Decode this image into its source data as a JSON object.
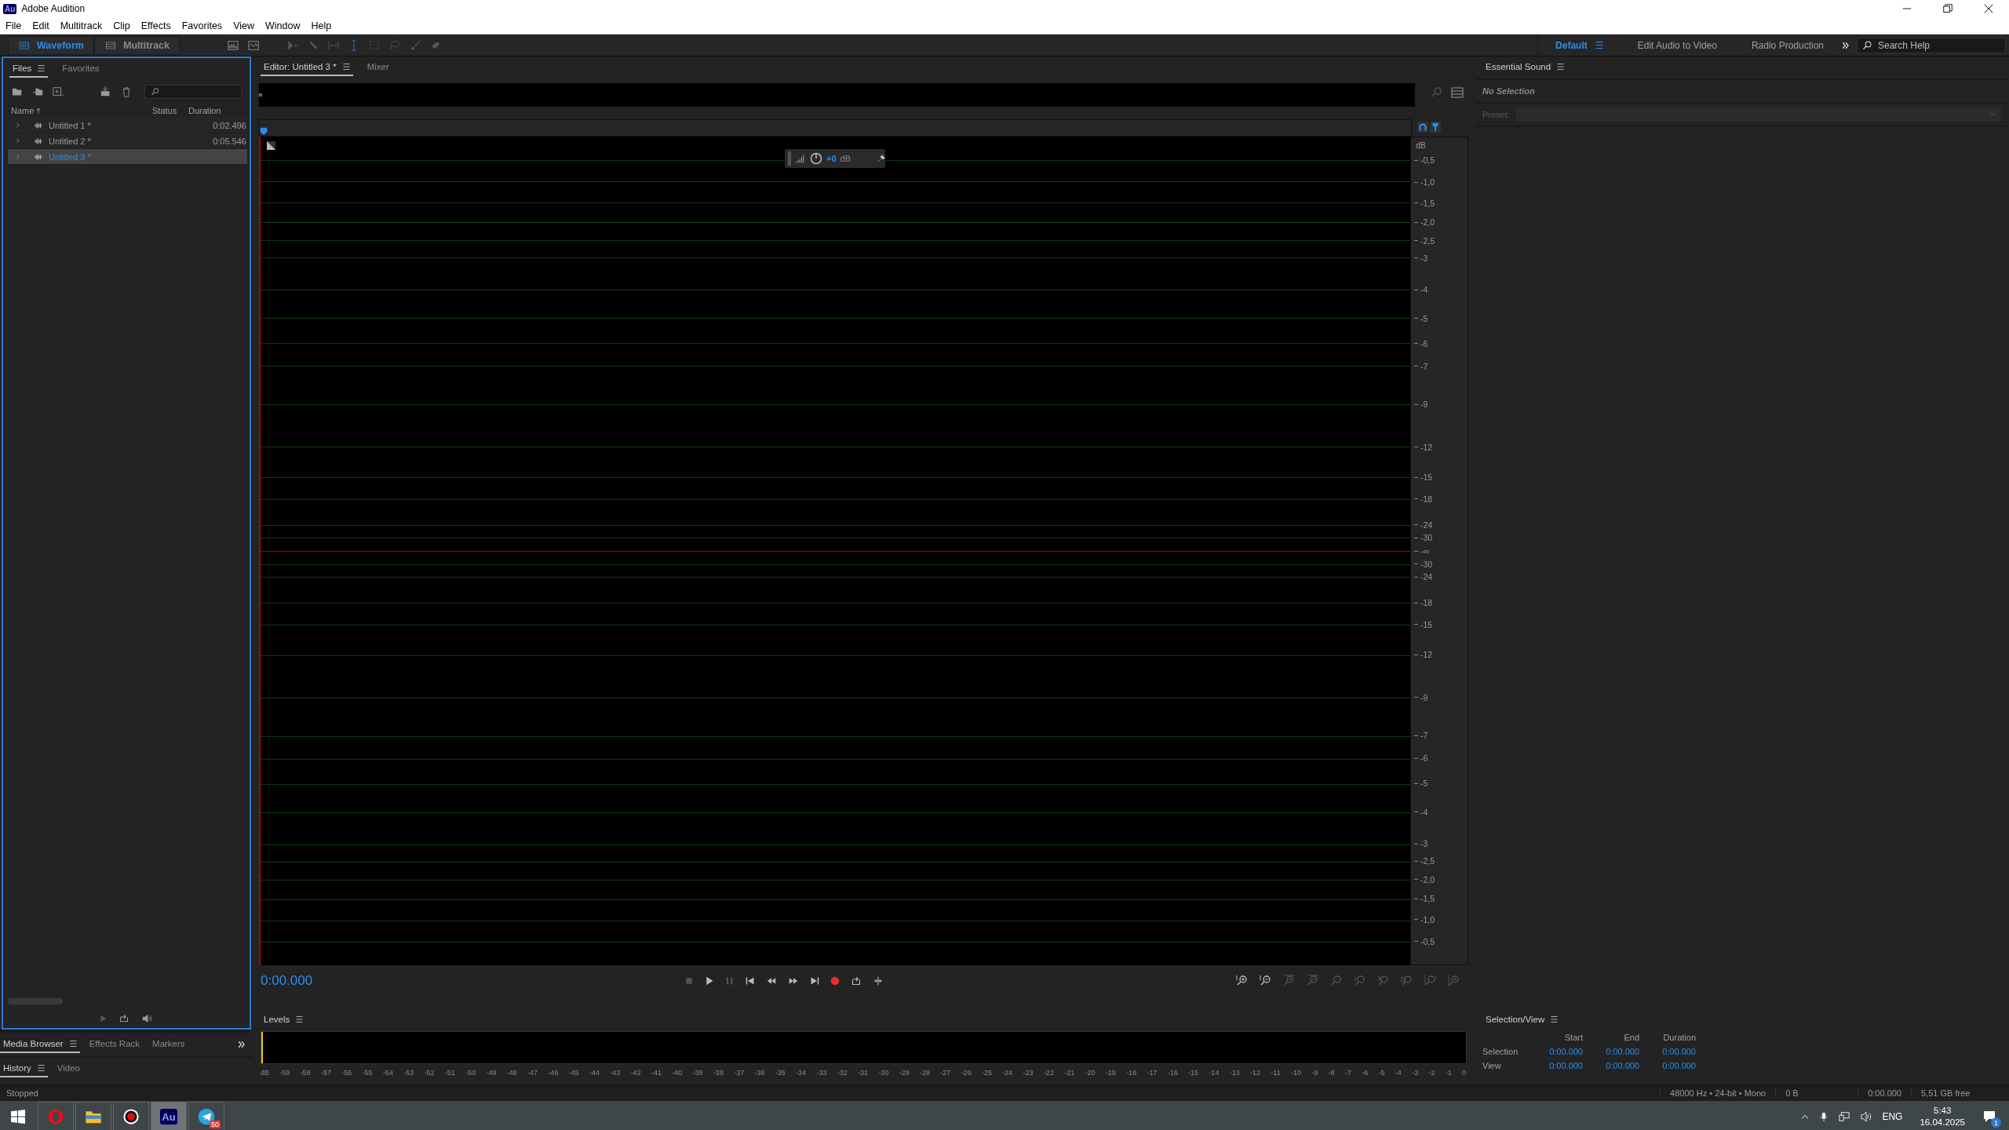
{
  "window": {
    "title": "Adobe Audition",
    "app_icon": "Au"
  },
  "menu": [
    "File",
    "Edit",
    "Multitrack",
    "Clip",
    "Effects",
    "Favorites",
    "View",
    "Window",
    "Help"
  ],
  "modes": [
    {
      "label": "Waveform",
      "selected": true
    },
    {
      "label": "Multitrack",
      "selected": false
    }
  ],
  "workspaces": [
    {
      "label": "Default",
      "selected": true
    },
    {
      "label": "Edit Audio to Video",
      "selected": false
    },
    {
      "label": "Radio Production",
      "selected": false
    }
  ],
  "search": {
    "placeholder": "Search Help"
  },
  "files_panel": {
    "tabs": [
      {
        "label": "Files",
        "selected": true
      },
      {
        "label": "Favorites",
        "selected": false
      }
    ],
    "columns": [
      "Name",
      "Status",
      "Duration"
    ],
    "rows": [
      {
        "name": "Untitled 1 *",
        "duration": "0:02.496",
        "selected": false
      },
      {
        "name": "Untitled 2 *",
        "duration": "0:05.546",
        "selected": false
      },
      {
        "name": "Untitled 3 *",
        "selected": true
      }
    ]
  },
  "editor": {
    "tabs": [
      {
        "label": "Editor: Untitled 3 *",
        "selected": true
      },
      {
        "label": "Mixer",
        "selected": false
      }
    ],
    "hud": {
      "value": "+0",
      "unit": "dB"
    },
    "scale_unit": "dB",
    "scale_labels": [
      "-0,5",
      "-1,0",
      "-1,5",
      "-2,0",
      "-2,5",
      "-3",
      "-4",
      "-5",
      "-6",
      "-7",
      "-9",
      "-12",
      "-15",
      "-18",
      "-24",
      "-30",
      "-∞",
      "-30",
      "-24",
      "-18",
      "-15",
      "-12",
      "-9",
      "-7",
      "-6",
      "-5",
      "-4",
      "-3",
      "-2,5",
      "-2,0",
      "-1,5",
      "-1,0",
      "-0,5"
    ],
    "time": "0:00.000"
  },
  "essential_sound": {
    "title": "Essential Sound",
    "status": "No Selection",
    "preset_label": "Preset:"
  },
  "bottom_tabs": [
    {
      "label": "Media Browser",
      "selected": true
    },
    {
      "label": "Effects Rack",
      "selected": false
    },
    {
      "label": "Markers",
      "selected": false
    }
  ],
  "history_tabs": [
    {
      "label": "History",
      "selected": true
    },
    {
      "label": "Video",
      "selected": false
    }
  ],
  "levels": {
    "title": "Levels",
    "unit": "dB",
    "ticks": [
      "-59",
      "-58",
      "-57",
      "-56",
      "-55",
      "-54",
      "-53",
      "-52",
      "-51",
      "-50",
      "-49",
      "-48",
      "-47",
      "-46",
      "-45",
      "-44",
      "-43",
      "-42",
      "-41",
      "-40",
      "-39",
      "-38",
      "-37",
      "-36",
      "-35",
      "-34",
      "-33",
      "-32",
      "-31",
      "-30",
      "-29",
      "-28",
      "-27",
      "-26",
      "-25",
      "-24",
      "-23",
      "-22",
      "-21",
      "-20",
      "-19",
      "-18",
      "-17",
      "-16",
      "-15",
      "-14",
      "-13",
      "-12",
      "-11",
      "-10",
      "-9",
      "-8",
      "-7",
      "-6",
      "-5",
      "-4",
      "-3",
      "-2",
      "-1",
      "0"
    ]
  },
  "selection_view": {
    "title": "Selection/View",
    "columns": [
      "Start",
      "End",
      "Duration"
    ],
    "rows": [
      {
        "label": "Selection",
        "values": [
          "0:00.000",
          "0:00.000",
          "0:00.000"
        ]
      },
      {
        "label": "View",
        "values": [
          "0:00.000",
          "0:00.000",
          "0:00.000"
        ]
      }
    ]
  },
  "status_bar": {
    "state": "Stopped",
    "format": "48000 Hz • 24-bit • Mono",
    "size": "0 B",
    "duration": "0:00.000",
    "free": "5,51 GB free"
  },
  "taskbar": {
    "apps": [
      {
        "kind": "opera",
        "selected": false
      },
      {
        "kind": "folder",
        "selected": false
      },
      {
        "kind": "recorder",
        "selected": false
      },
      {
        "kind": "audition",
        "label": "Au",
        "selected": true
      },
      {
        "kind": "telegram",
        "badge": "50",
        "selected": false
      }
    ],
    "language": "ENG",
    "time": "5:43",
    "date": "16.04.2025",
    "notifications": "1"
  }
}
